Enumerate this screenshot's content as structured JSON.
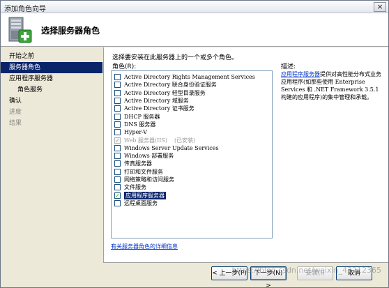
{
  "window": {
    "title": "添加角色向导",
    "close_glyph": "×"
  },
  "header": {
    "title": "选择服务器角色",
    "icon": "server-add-icon"
  },
  "nav": {
    "items": [
      {
        "label": "开始之前",
        "state": "normal",
        "indent": false
      },
      {
        "label": "服务器角色",
        "state": "active",
        "indent": false
      },
      {
        "label": "应用程序服务器",
        "state": "normal",
        "indent": false
      },
      {
        "label": "角色服务",
        "state": "normal",
        "indent": true
      },
      {
        "label": "确认",
        "state": "normal",
        "indent": false
      },
      {
        "label": "进度",
        "state": "disabled",
        "indent": false
      },
      {
        "label": "结果",
        "state": "disabled",
        "indent": false
      }
    ]
  },
  "content": {
    "instruction": "选择要安装在此服务器上的一个或多个角色。",
    "roles_label": "角色(R):",
    "description_label": "描述:",
    "roles": [
      {
        "label": "Active Directory Rights Management Services",
        "checked": false,
        "disabled": false,
        "status": ""
      },
      {
        "label": "Active Directory 联合身份验证服务",
        "checked": false,
        "disabled": false,
        "status": ""
      },
      {
        "label": "Active Directory 轻型目录服务",
        "checked": false,
        "disabled": false,
        "status": ""
      },
      {
        "label": "Active Directory 域服务",
        "checked": false,
        "disabled": false,
        "status": ""
      },
      {
        "label": "Active Directory 证书服务",
        "checked": false,
        "disabled": false,
        "status": ""
      },
      {
        "label": "DHCP 服务器",
        "checked": false,
        "disabled": false,
        "status": ""
      },
      {
        "label": "DNS 服务器",
        "checked": false,
        "disabled": false,
        "status": ""
      },
      {
        "label": "Hyper-V",
        "checked": false,
        "disabled": false,
        "status": ""
      },
      {
        "label": "Web 服务器(IIS)",
        "checked": true,
        "disabled": true,
        "status": "(已安装)"
      },
      {
        "label": "Windows Server Update Services",
        "checked": false,
        "disabled": false,
        "status": ""
      },
      {
        "label": "Windows 部署服务",
        "checked": false,
        "disabled": false,
        "status": ""
      },
      {
        "label": "传真服务器",
        "checked": false,
        "disabled": false,
        "status": ""
      },
      {
        "label": "打印和文件服务",
        "checked": false,
        "disabled": false,
        "status": ""
      },
      {
        "label": "网络策略和访问服务",
        "checked": false,
        "disabled": false,
        "status": ""
      },
      {
        "label": "文件服务",
        "checked": false,
        "disabled": false,
        "status": ""
      },
      {
        "label": "应用程序服务器",
        "checked": true,
        "disabled": false,
        "status": "",
        "selected": true
      },
      {
        "label": "远程桌面服务",
        "checked": false,
        "disabled": false,
        "status": ""
      }
    ],
    "description": {
      "link_text": "应用程序服务器",
      "body": "提供对高性能分布式业务应用程序(如那些使用 Enterprise Services 和 .NET Framework 3.5.1 构建的应用程序)的集中管理和承载。"
    },
    "more_info_link": "有关服务器角色的详细信息"
  },
  "footer": {
    "prev_label": "< 上一步(P)",
    "next_label": "下一步(N) >",
    "install_label": "安装(I)",
    "cancel_label": "取消"
  },
  "watermark": "https://blog.csdn.net/weixin_43212365"
}
